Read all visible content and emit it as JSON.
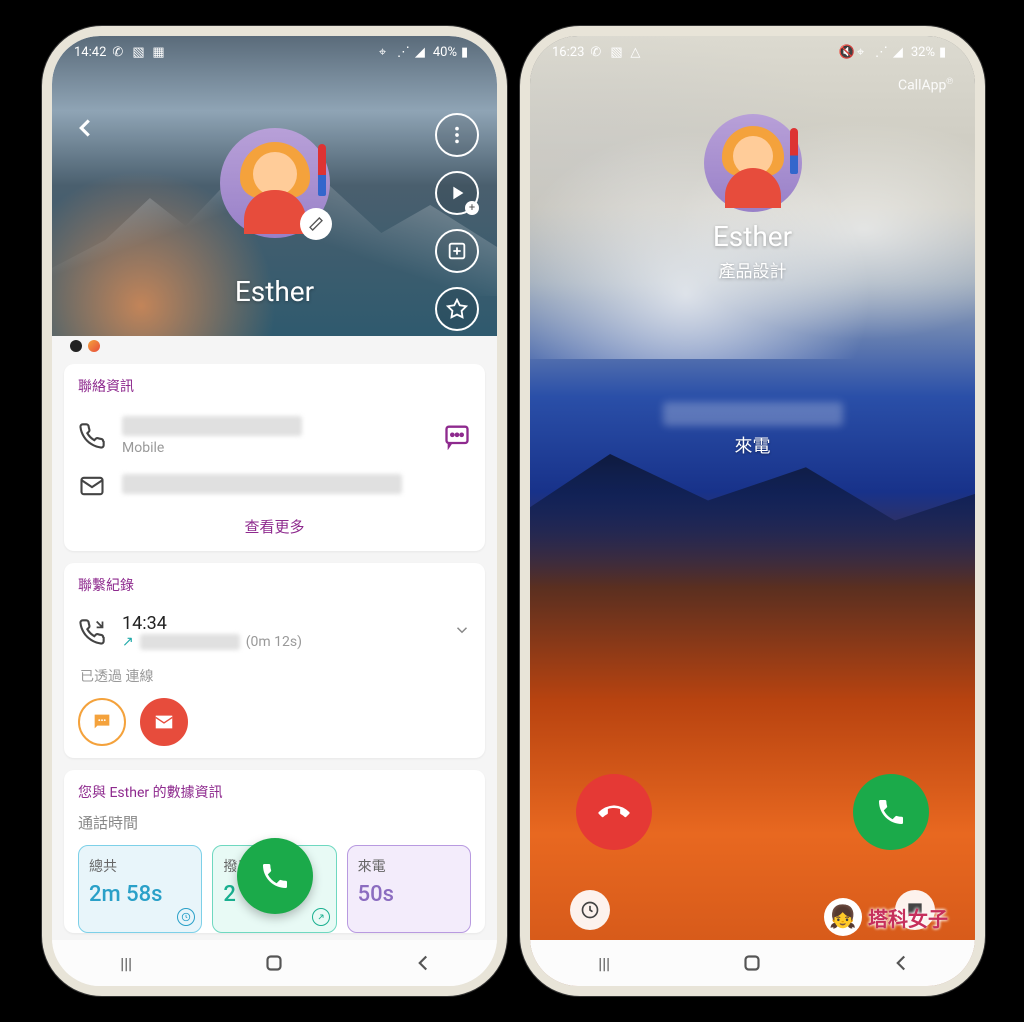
{
  "watermark": {
    "text": "塔科女子"
  },
  "left": {
    "status": {
      "time": "14:42",
      "battery": "40%"
    },
    "contact": {
      "name": "Esther"
    },
    "sections": {
      "info": {
        "title": "聯絡資訊",
        "phone_type": "Mobile",
        "view_more": "查看更多"
      },
      "log": {
        "title": "聯繫紀錄",
        "time": "14:34",
        "duration": "(0m 12s)",
        "via": "已透過 連線"
      },
      "stats": {
        "title": "您與 Esther 的數據資訊",
        "subtitle": "通話時間",
        "cards": [
          {
            "label": "總共",
            "value": "2m 58s"
          },
          {
            "label": "撥出",
            "value": "2"
          },
          {
            "label": "來電",
            "value": "50s"
          }
        ]
      }
    }
  },
  "right": {
    "status": {
      "time": "16:23",
      "battery": "32%"
    },
    "brand": "CallApp",
    "contact": {
      "name": "Esther",
      "subtitle": "產品設計"
    },
    "status_text": "來電"
  }
}
